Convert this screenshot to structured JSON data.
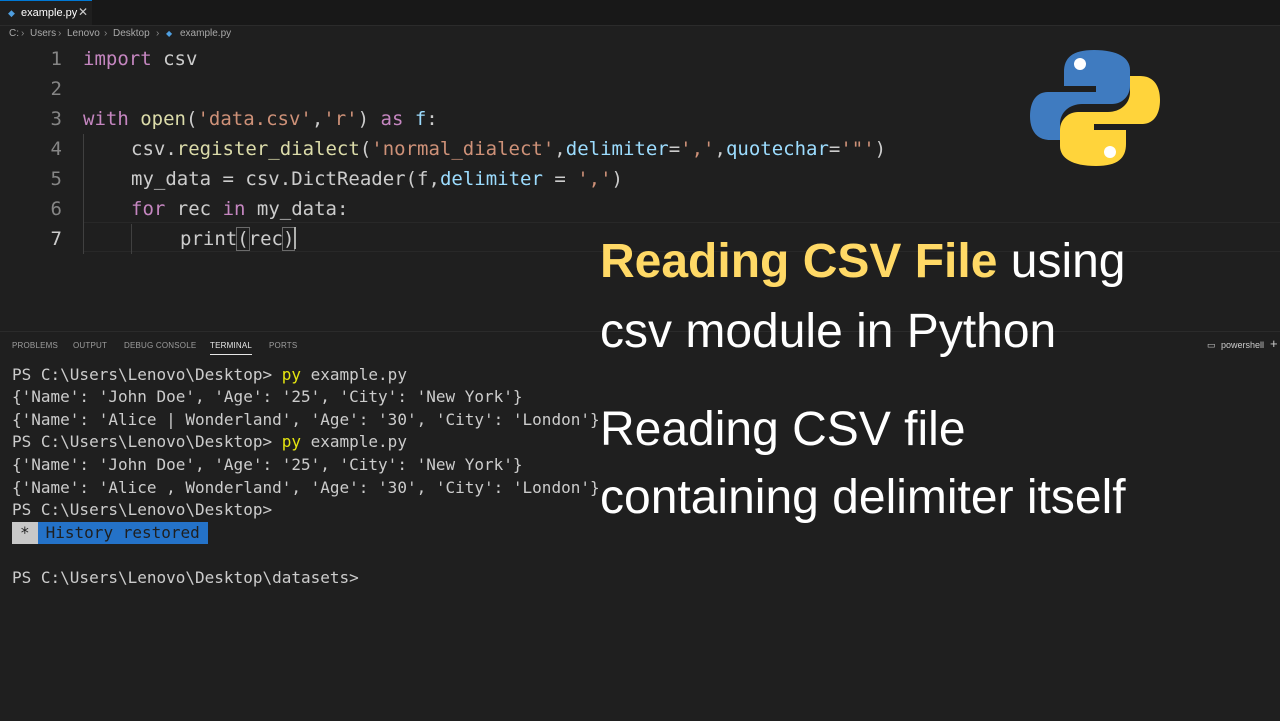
{
  "tab": {
    "icon": "python-file-icon",
    "label": "example.py",
    "close": "✕"
  },
  "breadcrumb": [
    "C:",
    "Users",
    "Lenovo",
    "Desktop",
    "example.py"
  ],
  "editor": {
    "line_numbers": [
      "1",
      "2",
      "3",
      "4",
      "5",
      "6",
      "7"
    ],
    "lines": {
      "l1": {
        "t1": "import",
        "t2": " csv"
      },
      "l3": {
        "t1": "with",
        "t2": " ",
        "t3": "open",
        "t4": "(",
        "t5": "'data.csv'",
        "t6": ",",
        "t7": "'r'",
        "t8": ") ",
        "t9": "as",
        "t10": " ",
        "t11": "f",
        "t12": ":"
      },
      "l4": {
        "t1": "csv",
        "t2": ".",
        "t3": "register_dialect",
        "t4": "(",
        "t5": "'normal_dialect'",
        "t6": ",",
        "t7": "delimiter",
        "t8": "=",
        "t9": "','",
        "t10": ",",
        "t11": "quotechar",
        "t12": "=",
        "t13": "'\"'",
        "t14": ")"
      },
      "l5": {
        "t1": "my_data",
        "t2": " = ",
        "t3": "csv",
        "t4": ".",
        "t5": "DictReader",
        "t6": "(",
        "t7": "f",
        "t8": ",",
        "t9": "delimiter",
        "t10": " = ",
        "t11": "','",
        "t12": ")"
      },
      "l6": {
        "t1": "for",
        "t2": " ",
        "t3": "rec",
        "t4": " ",
        "t5": "in",
        "t6": " ",
        "t7": "my_data",
        "t8": ":"
      },
      "l7": {
        "t1": "print",
        "t2": "(",
        "t3": "rec",
        "t4": ")"
      }
    }
  },
  "logo": "python-logo",
  "panel": {
    "tabs": [
      "PROBLEMS",
      "OUTPUT",
      "DEBUG CONSOLE",
      "TERMINAL",
      "PORTS"
    ],
    "active_tab": "TERMINAL",
    "shell": "powershell",
    "shell_icon": "terminal-icon",
    "add": "+"
  },
  "terminal": {
    "prompt1": "PS C:\\Users\\Lenovo\\Desktop> ",
    "cmd1": "py",
    "cmd1_rest": " example.py",
    "out1": "{'Name': 'John Doe', 'Age': '25', 'City': 'New York'}",
    "out2": "{'Name': 'Alice | Wonderland', 'Age': '30', 'City': 'London'}",
    "prompt2": "PS C:\\Users\\Lenovo\\Desktop> ",
    "cmd2": "py",
    "cmd2_rest": " example.py",
    "out3": "{'Name': 'John Doe', 'Age': '25', 'City': 'New York'}",
    "out4": "{'Name': 'Alice , Wonderland', 'Age': '30', 'City': 'London'}",
    "prompt3": "PS C:\\Users\\Lenovo\\Desktop>",
    "history_star": "*",
    "history_text": "History restored",
    "prompt4": "PS C:\\Users\\Lenovo\\Desktop\\datasets>"
  },
  "overlay": {
    "title_highlight": "Reading CSV File",
    "title_rest": " using",
    "title_line2": "csv module in Python",
    "sub_line1": "Reading CSV file",
    "sub_line2": "containing delimiter itself"
  },
  "colors": {
    "keyword": "#569cd6",
    "control_keyword": "#c586c0",
    "string": "#ce9178",
    "function": "#dcdcaa",
    "variable": "#9cdcfe",
    "highlight_text": "#ffd966",
    "history_bg": "#2472c8"
  }
}
